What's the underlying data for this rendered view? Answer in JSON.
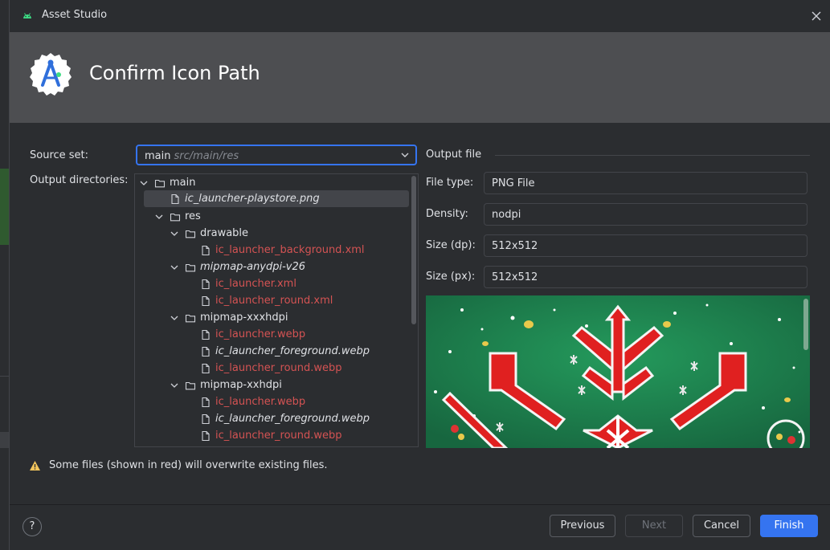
{
  "window": {
    "title": "Asset Studio"
  },
  "banner": {
    "heading": "Confirm Icon Path"
  },
  "form": {
    "source_set_label": "Source set:",
    "source_set_value": "main",
    "source_set_hint": "src/main/res",
    "output_dirs_label": "Output directories:"
  },
  "tree": {
    "root": "main",
    "playstore": "ic_launcher-playstore.png",
    "res": "res",
    "drawable": "drawable",
    "drawable_bg": "ic_launcher_background.xml",
    "anydpi": "mipmap-anydpi-v26",
    "anydpi_launcher": "ic_launcher.xml",
    "anydpi_round": "ic_launcher_round.xml",
    "xxxhdpi": "mipmap-xxxhdpi",
    "xxxhdpi_launcher": "ic_launcher.webp",
    "xxxhdpi_foreground": "ic_launcher_foreground.webp",
    "xxxhdpi_round": "ic_launcher_round.webp",
    "xxhdpi": "mipmap-xxhdpi",
    "xxhdpi_launcher": "ic_launcher.webp",
    "xxhdpi_foreground": "ic_launcher_foreground.webp",
    "xxhdpi_round": "ic_launcher_round.webp"
  },
  "output": {
    "section_title": "Output file",
    "file_type_label": "File type:",
    "file_type_value": "PNG File",
    "density_label": "Density:",
    "density_value": "nodpi",
    "size_dp_label": "Size (dp):",
    "size_dp_value": "512x512",
    "size_px_label": "Size (px):",
    "size_px_value": "512x512"
  },
  "warning": {
    "text": "Some files (shown in red) will overwrite existing files."
  },
  "buttons": {
    "help": "?",
    "previous": "Previous",
    "next": "Next",
    "cancel": "Cancel",
    "finish": "Finish"
  },
  "colors": {
    "accent": "#3574f0",
    "overwrite_red": "#d45353",
    "warning_yellow": "#f2c55c"
  }
}
